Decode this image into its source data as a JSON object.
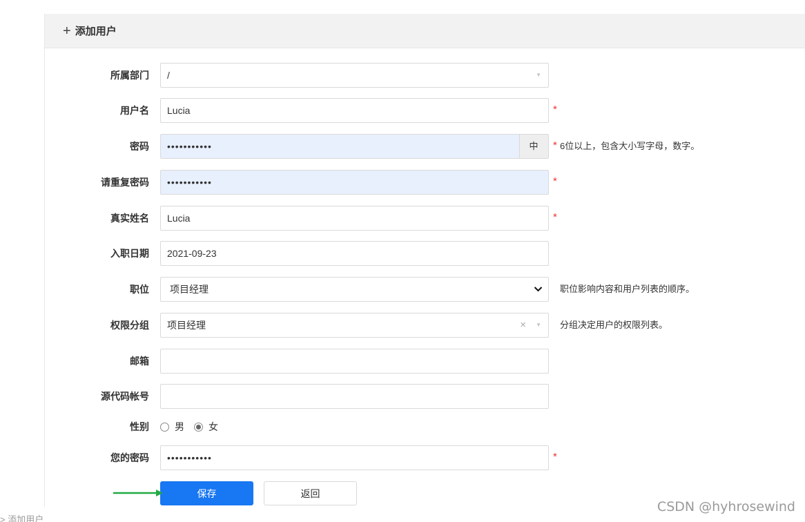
{
  "header": {
    "plus_glyph": "+",
    "title": "添加用户"
  },
  "form": {
    "department": {
      "label": "所属部门",
      "value": "/"
    },
    "username": {
      "label": "用户名",
      "value": "Lucia",
      "required": "*"
    },
    "password": {
      "label": "密码",
      "value": "•••••••••••",
      "addon": "中",
      "required": "*",
      "hint": "6位以上，包含大小写字母，数字。"
    },
    "password_confirm": {
      "label": "请重复密码",
      "value": "•••••••••••",
      "required": "*"
    },
    "realname": {
      "label": "真实姓名",
      "value": "Lucia",
      "required": "*"
    },
    "join_date": {
      "label": "入职日期",
      "value": "2021-09-23"
    },
    "role": {
      "label": "职位",
      "value": "项目经理",
      "hint": "职位影响内容和用户列表的顺序。"
    },
    "group": {
      "label": "权限分组",
      "value": "项目经理",
      "hint": "分组决定用户的权限列表。"
    },
    "email": {
      "label": "邮箱",
      "value": ""
    },
    "commiter": {
      "label": "源代码帐号",
      "value": ""
    },
    "gender": {
      "label": "性别",
      "options": [
        "男",
        "女"
      ],
      "selected": "女"
    },
    "verify_password": {
      "label": "您的密码",
      "value": "•••••••••••",
      "required": "*"
    }
  },
  "buttons": {
    "save": "保存",
    "back": "返回"
  },
  "breadcrumb": "> 添加用户",
  "watermark": "CSDN @hyhrosewind",
  "colors": {
    "primary": "#1877f2",
    "required": "#ee3333",
    "autofill": "#e8f0fe",
    "arrow": "#22aa44"
  }
}
